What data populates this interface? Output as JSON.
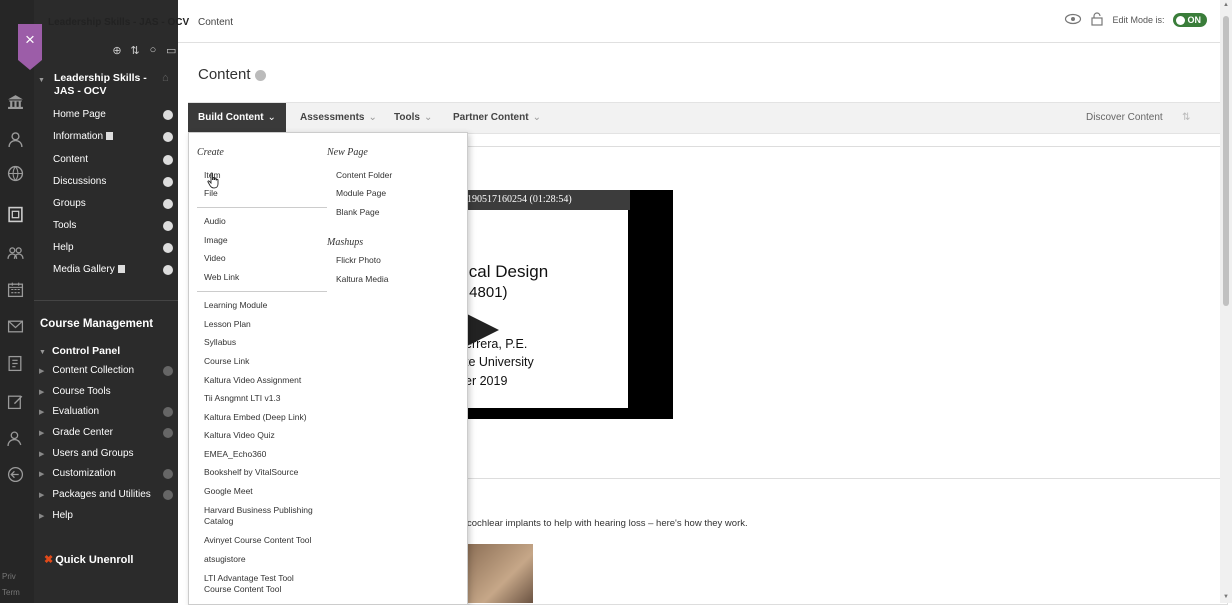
{
  "rail": {
    "icons": [
      "institution-icon",
      "user-icon",
      "globe-icon",
      "courses-icon",
      "groups-icon",
      "calendar-icon",
      "mail-icon",
      "grades-icon",
      "edit-icon",
      "user2-icon",
      "logout-icon"
    ],
    "footer": [
      "Priv",
      "Term"
    ]
  },
  "topbar": {
    "course_name": "Leadership Skills - JAS - OCV",
    "breadcrumb": "Content",
    "edit_mode_label": "Edit Mode is:",
    "edit_mode_value": "ON"
  },
  "course_menu": {
    "title": "Leadership Skills - JAS - OCV",
    "items": [
      {
        "label": "Home Page"
      },
      {
        "label": "Information"
      },
      {
        "label": "Content"
      },
      {
        "label": "Discussions"
      },
      {
        "label": "Groups"
      },
      {
        "label": "Tools"
      },
      {
        "label": "Help"
      },
      {
        "label": "Media Gallery"
      }
    ]
  },
  "course_management": {
    "title": "Course Management",
    "control_panel": "Control Panel",
    "items": [
      {
        "label": "Content Collection",
        "plus": true
      },
      {
        "label": "Course Tools",
        "plus": false
      },
      {
        "label": "Evaluation",
        "plus": true
      },
      {
        "label": "Grade Center",
        "plus": true
      },
      {
        "label": "Users and Groups",
        "plus": false
      },
      {
        "label": "Customization",
        "plus": true
      },
      {
        "label": "Packages and Utilities",
        "plus": true
      },
      {
        "label": "Help",
        "plus": false
      }
    ],
    "quick_unenroll": "Quick Unenroll"
  },
  "page": {
    "title": "Content"
  },
  "action_bar": {
    "build_content": "Build Content",
    "assessments": "Assessments",
    "tools": "Tools",
    "partner_content": "Partner Content",
    "discover_content": "Discover Content"
  },
  "dropdown": {
    "create_heading": "Create",
    "create_group1": [
      "Item",
      "File"
    ],
    "create_group2": [
      "Audio",
      "Image",
      "Video",
      "Web Link"
    ],
    "create_group3": [
      "Learning Module",
      "Lesson Plan",
      "Syllabus",
      "Course Link",
      "Kaltura Video Assignment",
      "Tii Asngmnt LTI v1.3",
      "Kaltura Embed (Deep Link)",
      "Kaltura Video Quiz",
      "EMEA_Echo360",
      "Bookshelf by VitalSource",
      "Google Meet"
    ],
    "create_group4": [
      "Harvard Business Publishing Catalog",
      "Avinyet Course Content Tool",
      "atsugistore",
      "LTI Advantage Test Tool Course Content Tool"
    ],
    "newpage_heading": "New Page",
    "newpage_items": [
      "Content Folder",
      "Module Page",
      "Blank Page"
    ],
    "mashups_heading": "Mashups",
    "mashups_items": [
      "Flickr Photo",
      "Kaltura Media"
    ]
  },
  "video": {
    "bar_text": "190517160254 (01:28:54)",
    "line1": "ical Design",
    "line2": ".4801)",
    "line3": "errera, P.E.",
    "line4": "te University",
    "line5": "er 2019"
  },
  "article": {
    "text": "cochlear implants to help with hearing loss – here's how they work."
  }
}
